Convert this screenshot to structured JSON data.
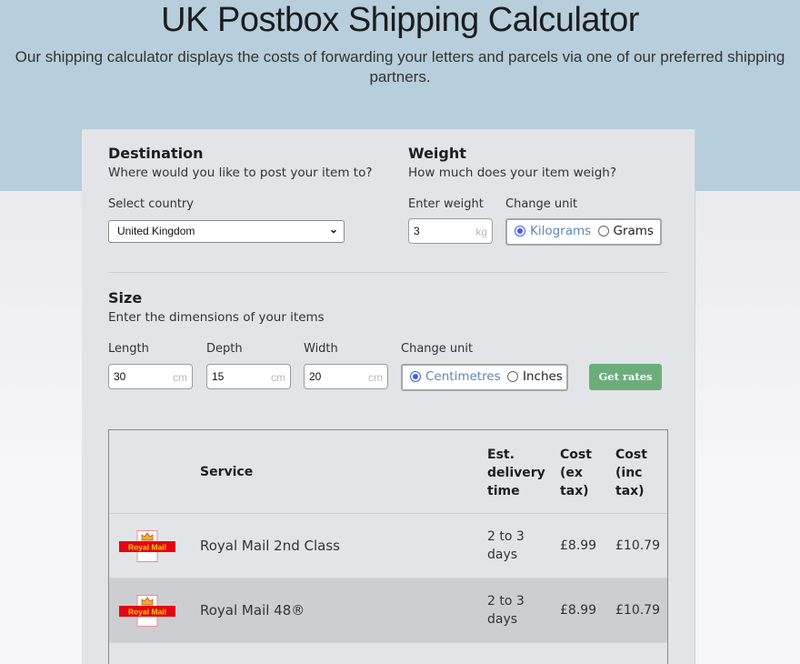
{
  "header": {
    "title": "UK Postbox Shipping Calculator",
    "subtitle": "Our shipping calculator displays the costs of forwarding your letters and parcels via one of our preferred shipping partners."
  },
  "destination": {
    "title": "Destination",
    "subtitle": "Where would you like to post your item to?",
    "country_label": "Select country",
    "country_value": "United Kingdom"
  },
  "weight": {
    "title": "Weight",
    "subtitle": "How much does your item weigh?",
    "enter_label": "Enter weight",
    "value": "3",
    "unit_suffix": "kg",
    "unit_label": "Change unit",
    "units": [
      {
        "label": "Kilograms",
        "selected": true
      },
      {
        "label": "Grams",
        "selected": false
      }
    ]
  },
  "size": {
    "title": "Size",
    "subtitle": "Enter the dimensions of your items",
    "fields": [
      {
        "label": "Length",
        "value": "30",
        "suffix": "cm"
      },
      {
        "label": "Depth",
        "value": "15",
        "suffix": "cm"
      },
      {
        "label": "Width",
        "value": "20",
        "suffix": "cm"
      }
    ],
    "unit_label": "Change unit",
    "units": [
      {
        "label": "Centimetres",
        "selected": true
      },
      {
        "label": "Inches",
        "selected": false
      }
    ],
    "submit_label": "Get rates"
  },
  "results": {
    "columns": [
      "",
      "Service",
      "Est.\ndelivery\ntime",
      "Cost\n(ex\ntax)",
      "Cost\n(inc\ntax)"
    ],
    "col_service": "Service",
    "col_delivery": [
      "Est.",
      "delivery",
      "time"
    ],
    "col_ex": [
      "Cost",
      "(ex",
      "tax)"
    ],
    "col_inc": [
      "Cost",
      "(inc",
      "tax)"
    ],
    "rows": [
      {
        "logo": "Royal Mail",
        "service": "Royal Mail 2nd Class",
        "delivery": [
          "2 to 3",
          "days"
        ],
        "cost_ex": "£8.99",
        "cost_inc": "£10.79"
      },
      {
        "logo": "Royal Mail",
        "service": "Royal Mail 48®",
        "delivery": [
          "2 to 3",
          "days"
        ],
        "cost_ex": "£8.99",
        "cost_inc": "£10.79"
      }
    ]
  },
  "colors": {
    "hero_bg": "#b7cedc",
    "button_green": "#6cae7b",
    "radio_selected": "#3d5df0",
    "royal_mail_red": "#e30613",
    "royal_mail_yellow": "#fcd000"
  }
}
